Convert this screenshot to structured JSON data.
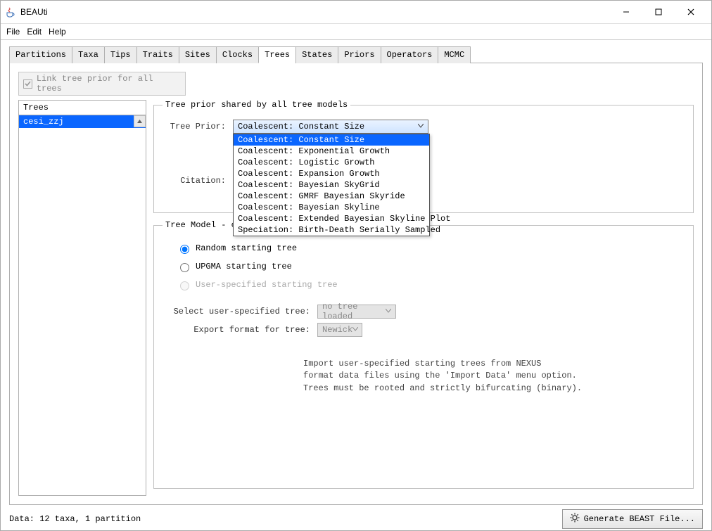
{
  "window": {
    "title": "BEAUti"
  },
  "menu": {
    "file": "File",
    "edit": "Edit",
    "help": "Help"
  },
  "tabs": {
    "items": [
      "Partitions",
      "Taxa",
      "Tips",
      "Traits",
      "Sites",
      "Clocks",
      "Trees",
      "States",
      "Priors",
      "Operators",
      "MCMC"
    ],
    "active": "Trees"
  },
  "link_checkbox": {
    "label": "Link tree prior for all trees",
    "checked": true
  },
  "sidebar": {
    "header": "Trees",
    "items": [
      "cesi_zzj"
    ],
    "selected": 0
  },
  "prior_group": {
    "legend": "Tree prior shared by all tree models",
    "tree_prior_label": "Tree Prior:",
    "tree_prior_value": "Coalescent: Constant Size",
    "citation_label": "Citation:",
    "options": [
      "Coalescent: Constant Size",
      "Coalescent: Exponential Growth",
      "Coalescent: Logistic Growth",
      "Coalescent: Expansion Growth",
      "Coalescent: Bayesian SkyGrid",
      "Coalescent: GMRF Bayesian Skyride",
      "Coalescent: Bayesian Skyline",
      "Coalescent: Extended Bayesian Skyline Plot",
      "Speciation: Birth-Death Serially Sampled"
    ],
    "selected_option": 0
  },
  "model_group": {
    "legend": "Tree Model - c",
    "radios": {
      "random": "Random starting tree",
      "upgma": "UPGMA starting tree",
      "user": "User-specified starting tree"
    },
    "user_tree_label": "Select user-specified tree:",
    "user_tree_value": "no tree loaded",
    "export_label": "Export format for tree:",
    "export_value": "Newick",
    "hint_line1": "Import user-specified starting trees from NEXUS",
    "hint_line2": "format data files using the 'Import Data' menu option.",
    "hint_line3": "Trees must be rooted and strictly bifurcating (binary)."
  },
  "status": {
    "text": "Data: 12 taxa, 1 partition"
  },
  "generate": {
    "label": "Generate BEAST File..."
  }
}
